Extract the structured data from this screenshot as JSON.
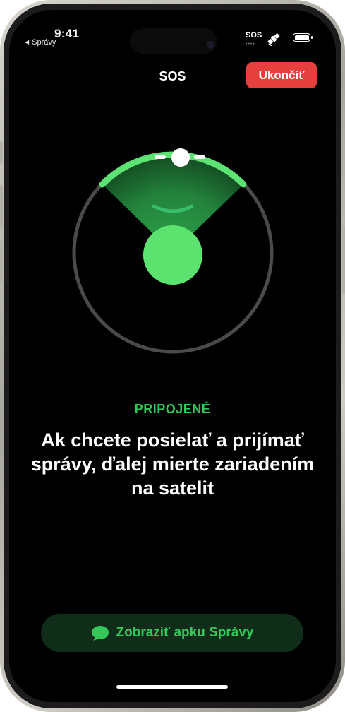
{
  "status_bar": {
    "time": "9:41",
    "back_label": "Správy",
    "sos_indicator": "SOS",
    "sos_dots": "••••"
  },
  "header": {
    "title": "SOS",
    "end_button": "Ukončiť"
  },
  "status_label": "PRIPOJENÉ",
  "message": "Ak chcete posielať a prijímať správy, ďalej mierte zariadením na satelit",
  "open_app_button": "Zobraziť apku Správy",
  "colors": {
    "accent_green": "#33c759",
    "end_button_red": "#e5403e",
    "button_bg": "#0f2d19"
  },
  "icons": [
    "satellite-icon",
    "battery-icon",
    "message-bubble-icon",
    "back-arrow-icon"
  ]
}
